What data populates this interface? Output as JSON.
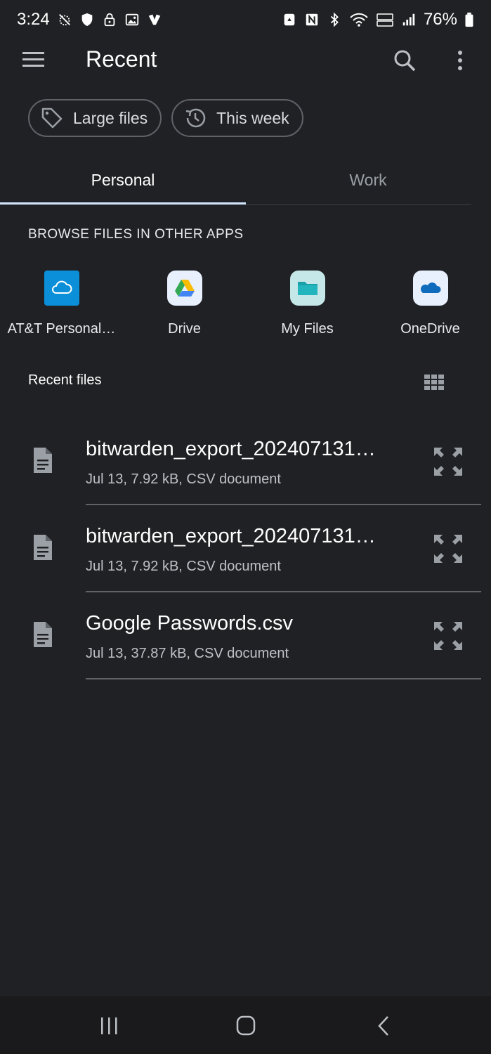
{
  "status_bar": {
    "time": "3:24",
    "battery": "76%"
  },
  "app_bar": {
    "title": "Recent",
    "menu_icon": "hamburger-menu-icon",
    "search_icon": "search-icon",
    "more_icon": "more-vert-icon"
  },
  "chips": [
    {
      "label": "Large files",
      "icon": "tag-icon"
    },
    {
      "label": "This week",
      "icon": "history-icon"
    }
  ],
  "tabs": [
    {
      "label": "Personal",
      "selected": true
    },
    {
      "label": "Work",
      "selected": false
    }
  ],
  "browse_section": {
    "title": "BROWSE FILES IN OTHER APPS",
    "apps": [
      {
        "label": "AT&T Personal…",
        "icon": "att-cloud-icon"
      },
      {
        "label": "Drive",
        "icon": "google-drive-icon"
      },
      {
        "label": "My Files",
        "icon": "my-files-folder-icon"
      },
      {
        "label": "OneDrive",
        "icon": "onedrive-icon"
      }
    ]
  },
  "recent_files": {
    "title": "Recent files",
    "items": [
      {
        "name": "bitwarden_export_202407131…",
        "meta": "Jul 13, 7.92 kB, CSV document"
      },
      {
        "name": "bitwarden_export_202407131…",
        "meta": "Jul 13, 7.92 kB, CSV document"
      },
      {
        "name": "Google Passwords.csv",
        "meta": "Jul 13, 37.87 kB, CSV document"
      }
    ]
  },
  "colors": {
    "background": "#202124",
    "tab_indicator": "#d2e3fc",
    "divider": "#5f6368"
  }
}
